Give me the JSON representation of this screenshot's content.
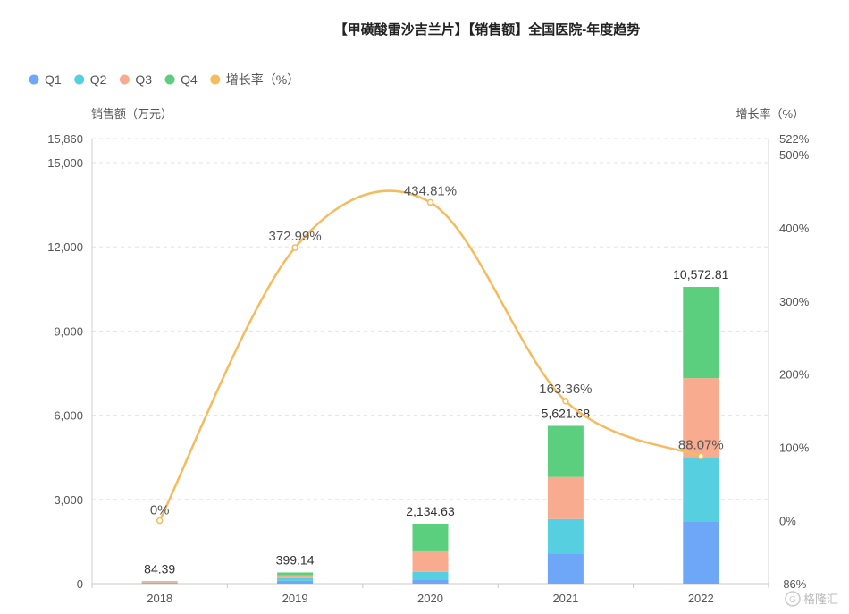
{
  "chart_data": {
    "type": "bar",
    "title": "【甲磺酸雷沙吉兰片】【销售额】全国医院-年度趋势",
    "categories": [
      "2018",
      "2019",
      "2020",
      "2021",
      "2022"
    ],
    "ylabel": "销售额（万元）",
    "y2label": "增长率（%）",
    "ylim": [
      0,
      15860
    ],
    "y2lim": [
      -86,
      522
    ],
    "y_ticks": [
      "0",
      "3,000",
      "6,000",
      "9,000",
      "12,000",
      "15,000",
      "15,860"
    ],
    "y_tick_values": [
      0,
      3000,
      6000,
      9000,
      12000,
      15000,
      15860
    ],
    "y2_ticks": [
      "-86%",
      "0%",
      "100%",
      "200%",
      "300%",
      "400%",
      "500%",
      "522%"
    ],
    "y2_tick_values": [
      -86,
      0,
      100,
      200,
      300,
      400,
      500,
      522
    ],
    "series": [
      {
        "name": "Q1",
        "color": "#6ea6f8",
        "values": [
          20,
          100,
          140,
          1070,
          2220
        ]
      },
      {
        "name": "Q2",
        "color": "#56d0e0",
        "values": [
          20,
          100,
          280,
          1230,
          2270
        ]
      },
      {
        "name": "Q3",
        "color": "#f9ab8f",
        "values": [
          22,
          100,
          760,
          1500,
          2830
        ]
      },
      {
        "name": "Q4",
        "color": "#5ccf7f",
        "values": [
          22.39,
          99.14,
          954.63,
          1821.68,
          3252.81
        ]
      }
    ],
    "totals": [
      84.39,
      399.14,
      2134.63,
      5621.68,
      10572.81
    ],
    "total_labels": [
      "84.39",
      "399.14",
      "2,134.63",
      "5,621.68",
      "10,572.81"
    ],
    "growth": {
      "name": "增长率（%）",
      "color": "#f6bb5c",
      "values": [
        0,
        372.99,
        434.81,
        163.36,
        88.07
      ],
      "labels": [
        "0%",
        "372.99%",
        "434.81%",
        "163.36%",
        "88.07%"
      ]
    },
    "grid": true,
    "legend_position": "top-left"
  },
  "watermark": "格隆汇"
}
